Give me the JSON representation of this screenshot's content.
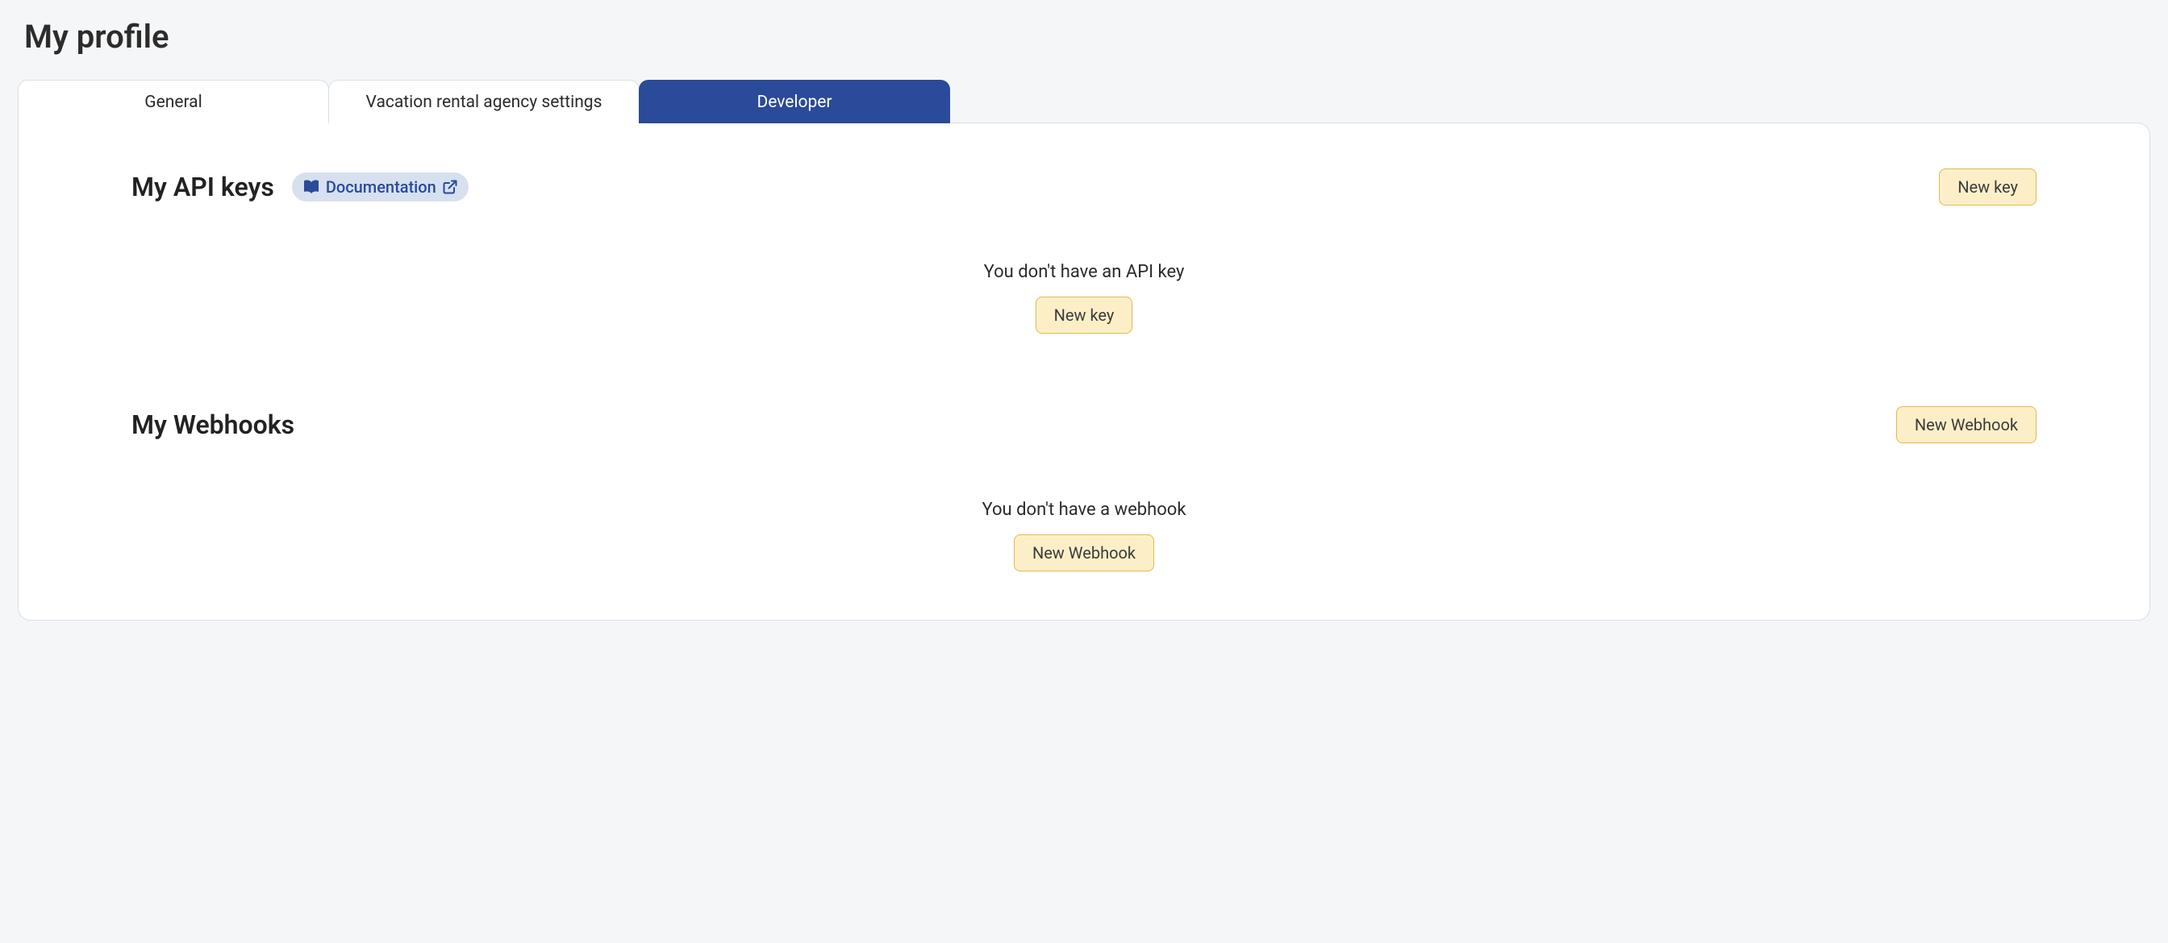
{
  "page": {
    "title": "My profile"
  },
  "tabs": [
    {
      "label": "General",
      "active": false
    },
    {
      "label": "Vacation rental agency settings",
      "active": false
    },
    {
      "label": "Developer",
      "active": true
    }
  ],
  "api_keys": {
    "title": "My API keys",
    "doc_label": "Documentation",
    "new_button": "New key",
    "empty_text": "You don't have an API key",
    "empty_button": "New key"
  },
  "webhooks": {
    "title": "My Webhooks",
    "new_button": "New Webhook",
    "empty_text": "You don't have a webhook",
    "empty_button": "New Webhook"
  },
  "colors": {
    "tab_active_bg": "#2a4a9a",
    "pill_bg": "#d6e0ef",
    "pill_text": "#2a4a9a",
    "btn_bg": "#fcefc8",
    "btn_border": "#e6b84e"
  }
}
